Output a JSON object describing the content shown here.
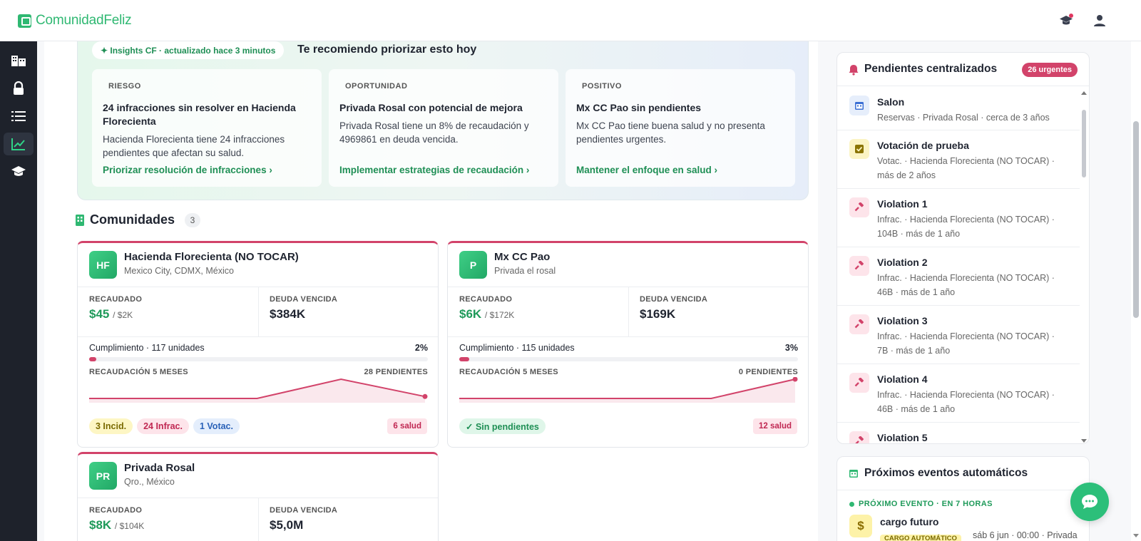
{
  "app": {
    "name": "ComunidadFeliz",
    "brand_color": "#2fb872",
    "accent_color": "#d2436a"
  },
  "header": {
    "icons": [
      "graduation-cap-icon",
      "user-icon"
    ]
  },
  "sidebar": {
    "items": [
      "building-icon",
      "lock-icon",
      "list-icon",
      "chart-icon",
      "graduation-cap-icon"
    ],
    "active": "chart-icon"
  },
  "insights": {
    "pill": "✦ Insights CF · actualizado hace 3 minutos",
    "title": "Te recomiendo priorizar esto hoy",
    "cards": [
      {
        "tag": "RIESGO",
        "title": "24 infracciones sin resolver en Hacienda Florecienta",
        "body": "Hacienda Florecienta tiene 24 infracciones pendientes que afectan su salud.",
        "link": "Priorizar resolución de infracciones ›"
      },
      {
        "tag": "OPORTUNIDAD",
        "title": "Privada Rosal con potencial de mejora",
        "body": "Privada Rosal tiene un 8% de recaudación y 4969861 en deuda vencida.",
        "link": "Implementar estrategias de recaudación ›"
      },
      {
        "tag": "POSITIVO",
        "title": "Mx CC Pao sin pendientes",
        "body": "Mx CC Pao tiene buena salud y no presenta pendientes urgentes.",
        "link": "Mantener el enfoque en salud ›"
      }
    ]
  },
  "communities": {
    "title": "Comunidades",
    "count": "3",
    "items": [
      {
        "initials": "HF",
        "name": "Hacienda Florecienta (NO TOCAR)",
        "location": "Mexico City, CDMX, México",
        "recaudado_label": "RECAUDADO",
        "recaudado": "$45",
        "recaudado_of": "/ $2K",
        "deuda_label": "DEUDA VENCIDA",
        "deuda": "$384K",
        "cumplimiento": "Cumplimiento · 117 unidades",
        "pct": "2%",
        "pct_value": 2,
        "recaudacion_label": "RECAUDACIÓN 5 MESES",
        "pendientes": "28 PENDIENTES",
        "trend": [
          0,
          0,
          0,
          1,
          0.1
        ],
        "chips": [
          {
            "text": "3 Incid.",
            "kind": "y"
          },
          {
            "text": "24 Infrac.",
            "kind": "r"
          },
          {
            "text": "1 Votac.",
            "kind": "b"
          }
        ],
        "health": "6 salud"
      },
      {
        "initials": "P",
        "name": "Mx CC Pao",
        "location": "Privada el rosal",
        "recaudado_label": "RECAUDADO",
        "recaudado": "$6K",
        "recaudado_of": "/ $172K",
        "deuda_label": "DEUDA VENCIDA",
        "deuda": "$169K",
        "cumplimiento": "Cumplimiento · 115 unidades",
        "pct": "3%",
        "pct_value": 3,
        "recaudacion_label": "RECAUDACIÓN 5 MESES",
        "pendientes": "0 PENDIENTES",
        "trend": [
          0,
          0,
          0,
          0,
          1
        ],
        "chips": [
          {
            "text": "✓ Sin pendientes",
            "kind": "g"
          }
        ],
        "health": "12 salud"
      },
      {
        "initials": "PR",
        "name": "Privada Rosal",
        "location": "Qro., México",
        "recaudado_label": "RECAUDADO",
        "recaudado": "$8K",
        "recaudado_of": "/ $104K",
        "deuda_label": "DEUDA VENCIDA",
        "deuda": "$5,0M"
      }
    ]
  },
  "pending": {
    "title": "Pendientes centralizados",
    "badge": "26 urgentes",
    "items": [
      {
        "icon": "calendar-icon",
        "title": "Salon",
        "sub": "Reservas · Privada Rosal · cerca de 3 años"
      },
      {
        "icon": "checkbox-icon",
        "title": "Votación de prueba",
        "sub": "Votac. · Hacienda Florecienta (NO TOCAR) · más de 2 años"
      },
      {
        "icon": "gavel-icon",
        "title": "Violation 1",
        "sub": "Infrac. · Hacienda Florecienta (NO TOCAR) · 104B · más de 1 año"
      },
      {
        "icon": "gavel-icon",
        "title": "Violation 2",
        "sub": "Infrac. · Hacienda Florecienta (NO TOCAR) · 46B · más de 1 año"
      },
      {
        "icon": "gavel-icon",
        "title": "Violation 3",
        "sub": "Infrac. · Hacienda Florecienta (NO TOCAR) · 7B · más de 1 año"
      },
      {
        "icon": "gavel-icon",
        "title": "Violation 4",
        "sub": "Infrac. · Hacienda Florecienta (NO TOCAR) · 46B · más de 1 año"
      },
      {
        "icon": "gavel-icon",
        "title": "Violation 5",
        "sub": ""
      }
    ]
  },
  "events": {
    "title": "Próximos eventos automáticos",
    "next_label": "PRÓXIMO EVENTO · EN 7 HORAS",
    "event_title": "cargo futuro",
    "event_chip": "CARGO AUTOMÁTICO",
    "event_sub": "sáb 6 jun · 00:00 · Privada"
  }
}
